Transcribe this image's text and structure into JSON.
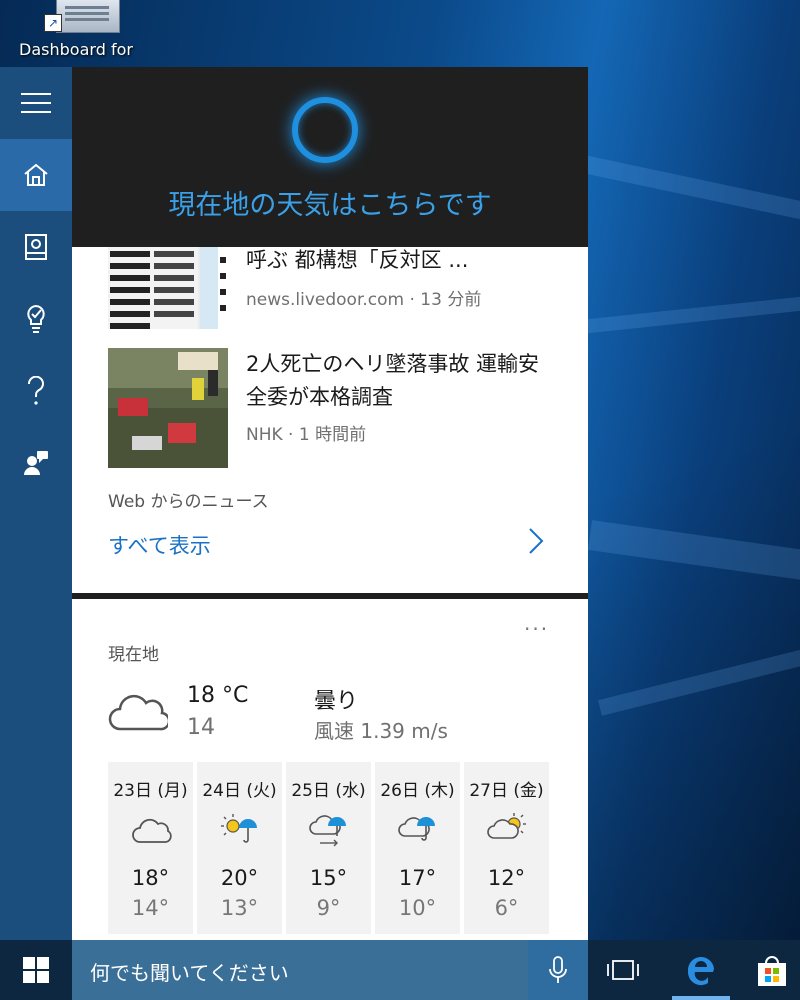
{
  "desktop": {
    "shortcut_label": "Dashboard for"
  },
  "cortana": {
    "header_text": "現在地の天気はこちらです"
  },
  "rail": {
    "items": [
      {
        "icon": "hamburger-menu-icon"
      },
      {
        "icon": "home-icon"
      },
      {
        "icon": "notebook-icon"
      },
      {
        "icon": "reminders-icon"
      },
      {
        "icon": "help-icon"
      },
      {
        "icon": "feedback-icon"
      }
    ]
  },
  "news": {
    "items": [
      {
        "title": "呼ぶ 都構想「反対区 ...",
        "source": "news.livedoor.com",
        "time": "13 分前",
        "meta": "news.livedoor.com · 13 分前"
      },
      {
        "title": "2人死亡のヘリ墜落事故 運輸安全委が本格調査",
        "title_line1": "2人死亡のヘリ墜落事故 運輸安",
        "title_line2": "全委が本格調査",
        "source": "NHK",
        "time": "1 時間前",
        "meta": "NHK · 1 時間前"
      }
    ],
    "section_label": "Web からのニュース",
    "show_all": "すべて表示"
  },
  "weather": {
    "more": "...",
    "location": "現在地",
    "temperature": "18 °C",
    "feels_like": "14",
    "condition": "曇り",
    "wind": "風速 1.39 m/s",
    "forecast": [
      {
        "day": "23日 (月)",
        "icon": "cloudy-icon",
        "high": "18°",
        "low": "14°"
      },
      {
        "day": "24日 (火)",
        "icon": "sun-rain-icon",
        "high": "20°",
        "low": "13°"
      },
      {
        "day": "25日 (水)",
        "icon": "cloud-rain-wind-icon",
        "high": "15°",
        "low": "9°"
      },
      {
        "day": "26日 (木)",
        "icon": "cloud-rain-icon",
        "high": "17°",
        "low": "10°"
      },
      {
        "day": "27日 (金)",
        "icon": "partly-sunny-icon",
        "high": "12°",
        "low": "6°"
      }
    ]
  },
  "taskbar": {
    "search_placeholder": "何でも聞いてください",
    "colors": {
      "taskbar": "#0d2740",
      "search": "#3a6f98",
      "accent": "#1f8fe0"
    }
  }
}
